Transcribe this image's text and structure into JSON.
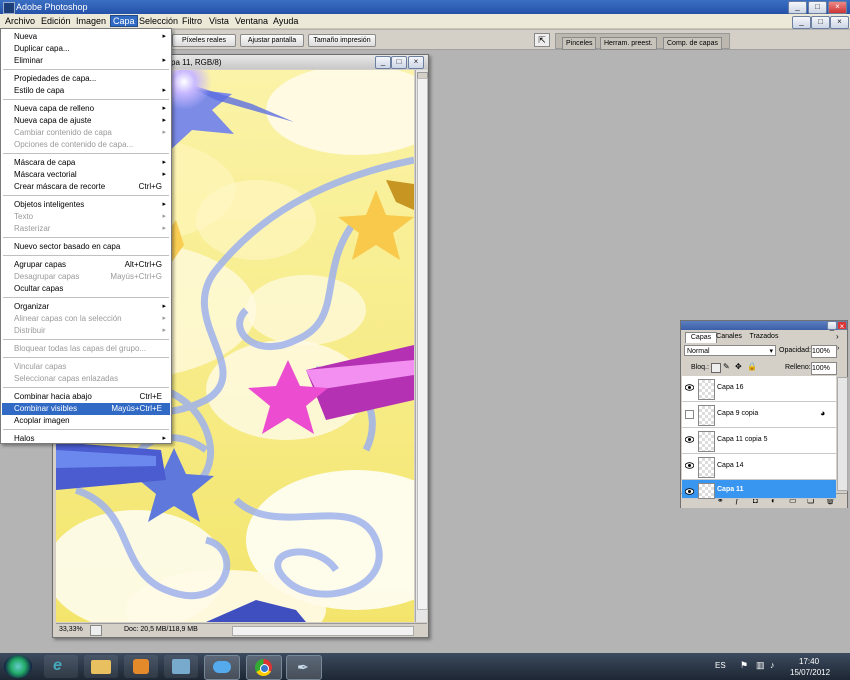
{
  "app": {
    "title": "Adobe Photoshop"
  },
  "window_buttons": [
    "_",
    "□",
    "×"
  ],
  "menubar": [
    "Archivo",
    "Edición",
    "Imagen",
    "Capa",
    "Selección",
    "Filtro",
    "Vista",
    "Ventana",
    "Ayuda"
  ],
  "active_menu": "Capa",
  "options_bar": {
    "buttons": [
      "Píxeles reales",
      "Ajustar pantalla",
      "Tamaño impresión"
    ]
  },
  "palette_well": {
    "tabs": [
      "Pinceles",
      "Herram. preest.",
      "Comp. de capas"
    ]
  },
  "document": {
    "title_fragment": "pa 11, RGB/8)",
    "zoom": "33,33%",
    "doc_info": "Doc: 20,5 MB/118,9 MB"
  },
  "menu": {
    "items": [
      {
        "label": "Nueva",
        "submenu": true
      },
      {
        "label": "Duplicar capa..."
      },
      {
        "label": "Eliminar",
        "submenu": true
      },
      {
        "sep": true
      },
      {
        "label": "Propiedades de capa..."
      },
      {
        "label": "Estilo de capa",
        "submenu": true
      },
      {
        "sep": true
      },
      {
        "label": "Nueva capa de relleno",
        "submenu": true
      },
      {
        "label": "Nueva capa de ajuste",
        "submenu": true
      },
      {
        "label": "Cambiar contenido de capa",
        "submenu": true,
        "disabled": true
      },
      {
        "label": "Opciones de contenido de capa...",
        "disabled": true
      },
      {
        "sep": true
      },
      {
        "label": "Máscara de capa",
        "submenu": true
      },
      {
        "label": "Máscara vectorial",
        "submenu": true
      },
      {
        "label": "Crear máscara de recorte",
        "shortcut": "Ctrl+G"
      },
      {
        "sep": true
      },
      {
        "label": "Objetos inteligentes",
        "submenu": true
      },
      {
        "label": "Texto",
        "submenu": true,
        "disabled": true
      },
      {
        "label": "Rasterizar",
        "submenu": true,
        "disabled": true
      },
      {
        "sep": true
      },
      {
        "label": "Nuevo sector basado en capa"
      },
      {
        "sep": true
      },
      {
        "label": "Agrupar capas",
        "shortcut": "Alt+Ctrl+G"
      },
      {
        "label": "Desagrupar capas",
        "shortcut": "Mayús+Ctrl+G",
        "disabled": true
      },
      {
        "label": "Ocultar capas"
      },
      {
        "sep": true
      },
      {
        "label": "Organizar",
        "submenu": true
      },
      {
        "label": "Alinear capas con la selección",
        "submenu": true,
        "disabled": true
      },
      {
        "label": "Distribuir",
        "submenu": true,
        "disabled": true
      },
      {
        "sep": true
      },
      {
        "label": "Bloquear todas las capas del grupo...",
        "disabled": true
      },
      {
        "sep": true
      },
      {
        "label": "Vincular capas",
        "disabled": true
      },
      {
        "label": "Seleccionar capas enlazadas",
        "disabled": true
      },
      {
        "sep": true
      },
      {
        "label": "Combinar hacia abajo",
        "shortcut": "Ctrl+E"
      },
      {
        "label": "Combinar visibles",
        "shortcut": "Mayús+Ctrl+E",
        "highlighted": true
      },
      {
        "label": "Acoplar imagen"
      },
      {
        "sep": true
      },
      {
        "label": "Halos",
        "submenu": true
      }
    ]
  },
  "layers_panel": {
    "tabs": [
      "Capas",
      "Canales",
      "Trazados"
    ],
    "blend_mode": "Normal",
    "opacity_label": "Opacidad:",
    "opacity": "100%",
    "lock_label": "Bloq.:",
    "fill_label": "Relleno:",
    "fill": "100%",
    "layers": [
      {
        "name": "Capa 16",
        "visible": true
      },
      {
        "name": "Capa 9 copia",
        "visible": false,
        "has_fx": true
      },
      {
        "name": "Capa 11 copia 5",
        "visible": true
      },
      {
        "name": "Capa 14",
        "visible": true
      },
      {
        "name": "Capa 11",
        "visible": true,
        "selected": true
      }
    ]
  },
  "taskbar": {
    "lang": "ES",
    "time": "17:40",
    "date": "15/07/2012",
    "apps": [
      "start-orb",
      "internet-explorer",
      "file-explorer",
      "media-player",
      "app-paint",
      "app-network",
      "chrome",
      "photoshop-feather"
    ]
  },
  "colors": {
    "menu_highlight": "#316ac5",
    "layer_selected": "#3895f0",
    "title_blue": "#2452a8"
  }
}
